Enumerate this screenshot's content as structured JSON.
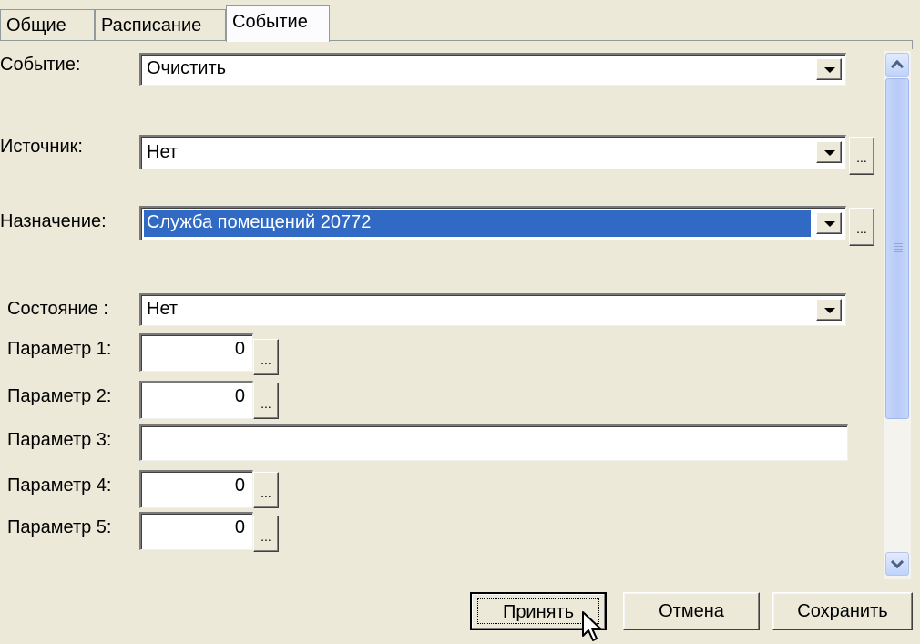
{
  "tabs": [
    {
      "label": "Общие",
      "active": false
    },
    {
      "label": "Расписание",
      "active": false
    },
    {
      "label": "Событие",
      "active": true
    }
  ],
  "form": {
    "event": {
      "label": "Событие:",
      "value": "Очистить"
    },
    "source": {
      "label": "Источник:",
      "value": "Нет",
      "browse": "..."
    },
    "destination": {
      "label": "Назначение:",
      "value": "Служба помещений 20772",
      "browse": "..."
    },
    "state": {
      "label": "Состояние :",
      "value": "Нет"
    },
    "param1": {
      "label": "Параметр 1:",
      "value": "0",
      "browse": "..."
    },
    "param2": {
      "label": "Параметр 2:",
      "value": "0",
      "browse": "..."
    },
    "param3": {
      "label": "Параметр 3:",
      "value": ""
    },
    "param4": {
      "label": "Параметр 4:",
      "value": "0",
      "browse": "..."
    },
    "param5": {
      "label": "Параметр 5:",
      "value": "0",
      "browse": "..."
    }
  },
  "buttons": {
    "accept": "Принять",
    "cancel": "Отмена",
    "save": "Сохранить"
  },
  "colors": {
    "background": "#ece9d8",
    "selection": "#316ac5",
    "scrollbar_accent": "#c1d3fb"
  }
}
